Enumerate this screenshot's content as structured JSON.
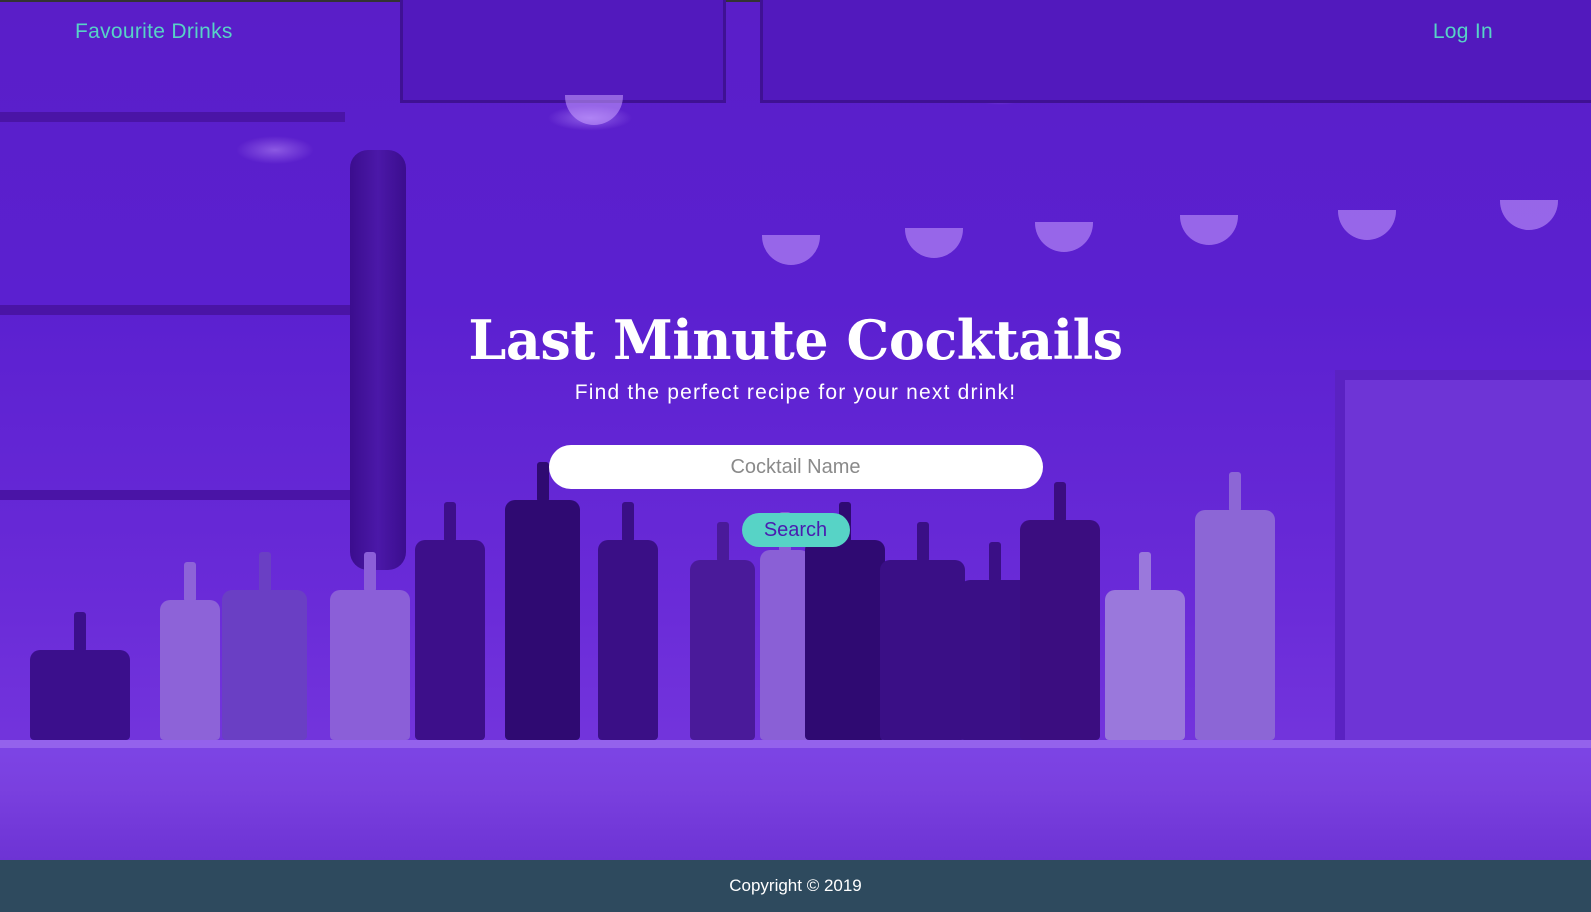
{
  "nav": {
    "left_link": "Favourite Drinks",
    "right_link": "Log In"
  },
  "hero": {
    "title": "Last Minute Cocktails",
    "subtitle": "Find the perfect recipe for your next drink!",
    "background_image": "bar-shelves-with-bottles-image",
    "overlay_color": "#5b20d0"
  },
  "search": {
    "placeholder": "Cocktail Name",
    "value": "",
    "button_label": "Search"
  },
  "footer": {
    "copyright": "Copyright © 2019"
  },
  "colors": {
    "accent": "#57d3c6",
    "overlay": "#5b20d0",
    "footer": "#2e4a5e",
    "text": "#ffffff"
  }
}
